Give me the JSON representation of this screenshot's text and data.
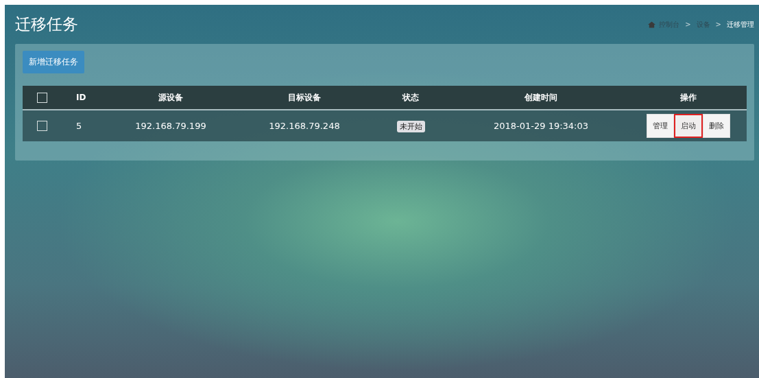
{
  "page_title": "迁移任务",
  "breadcrumb": [
    {
      "label": "控制台",
      "kind": "home",
      "current": false
    },
    {
      "label": "设备",
      "kind": "link",
      "current": false
    },
    {
      "label": "迁移管理",
      "kind": "link",
      "current": true
    }
  ],
  "breadcrumb_separator": ">",
  "add_button": "新增迁移任务",
  "table": {
    "columns": [
      "ID",
      "源设备",
      "目标设备",
      "状态",
      "创建时间",
      "操作"
    ],
    "header_checked": false,
    "rows": [
      {
        "checked": false,
        "id": "5",
        "source": "192.168.79.199",
        "target": "192.168.79.248",
        "status": "未开始",
        "created": "2018-01-29 19:34:03",
        "actions": [
          {
            "label": "管理",
            "highlighted": false
          },
          {
            "label": "启动",
            "highlighted": true
          },
          {
            "label": "删除",
            "highlighted": false
          }
        ]
      }
    ]
  }
}
